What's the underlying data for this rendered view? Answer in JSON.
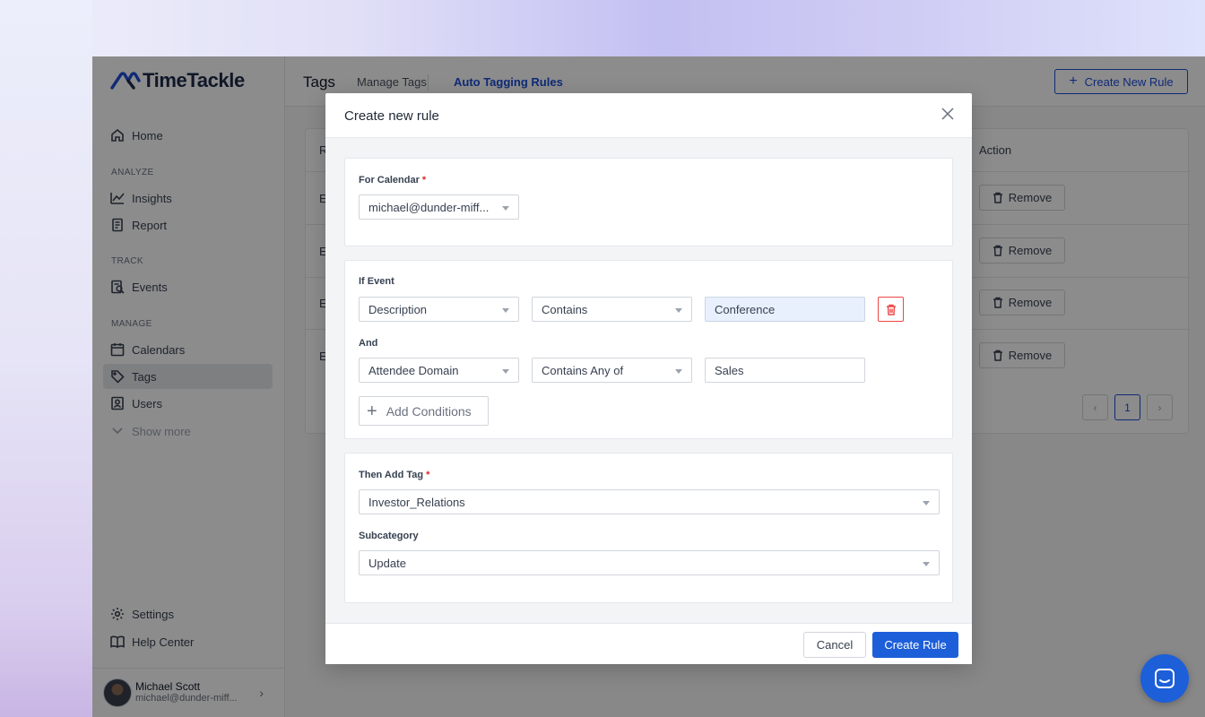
{
  "app": {
    "brand": "TimeTackle"
  },
  "sidebar": {
    "home": "Home",
    "sections": {
      "analyze": "ANALYZE",
      "track": "TRACK",
      "manage": "MANAGE"
    },
    "items": {
      "insights": "Insights",
      "report": "Report",
      "events": "Events",
      "calendars": "Calendars",
      "tags": "Tags",
      "users": "Users",
      "show_more": "Show more",
      "settings": "Settings",
      "help_center": "Help Center"
    },
    "user": {
      "name": "Michael Scott",
      "email": "michael@dunder-miff..."
    }
  },
  "topbar": {
    "title": "Tags",
    "tabs": [
      "Manage Tags",
      "Auto Tagging Rules"
    ],
    "active_tab": "Auto Tagging Rules",
    "create_button": "Create New Rule"
  },
  "table": {
    "col_first": "R",
    "col_action": "Action",
    "row_prefix": "E",
    "remove_label": "Remove",
    "rows_count_visible": 4,
    "pagination": {
      "prev": "‹",
      "current": "1",
      "next": "›"
    }
  },
  "modal": {
    "title": "Create new rule",
    "calendar": {
      "label": "For Calendar",
      "required_mark": "*",
      "value": "michael@dunder-miff..."
    },
    "conditions": {
      "label": "If Event",
      "and_label": "And",
      "rows": [
        {
          "field": "Description",
          "operator": "Contains",
          "value": "Conference"
        },
        {
          "field": "Attendee Domain",
          "operator": "Contains Any of",
          "value": "Sales"
        }
      ],
      "add_button": "Add Conditions"
    },
    "tag": {
      "label": "Then Add Tag",
      "required_mark": "*",
      "value": "Investor_Relations",
      "subcategory_label": "Subcategory",
      "subcategory_value": "Update"
    },
    "footer": {
      "cancel": "Cancel",
      "create": "Create Rule"
    }
  },
  "colors": {
    "primary": "#1d5fd9",
    "danger": "#ef4444",
    "overlay": "rgba(0,0,0,0.45)"
  }
}
